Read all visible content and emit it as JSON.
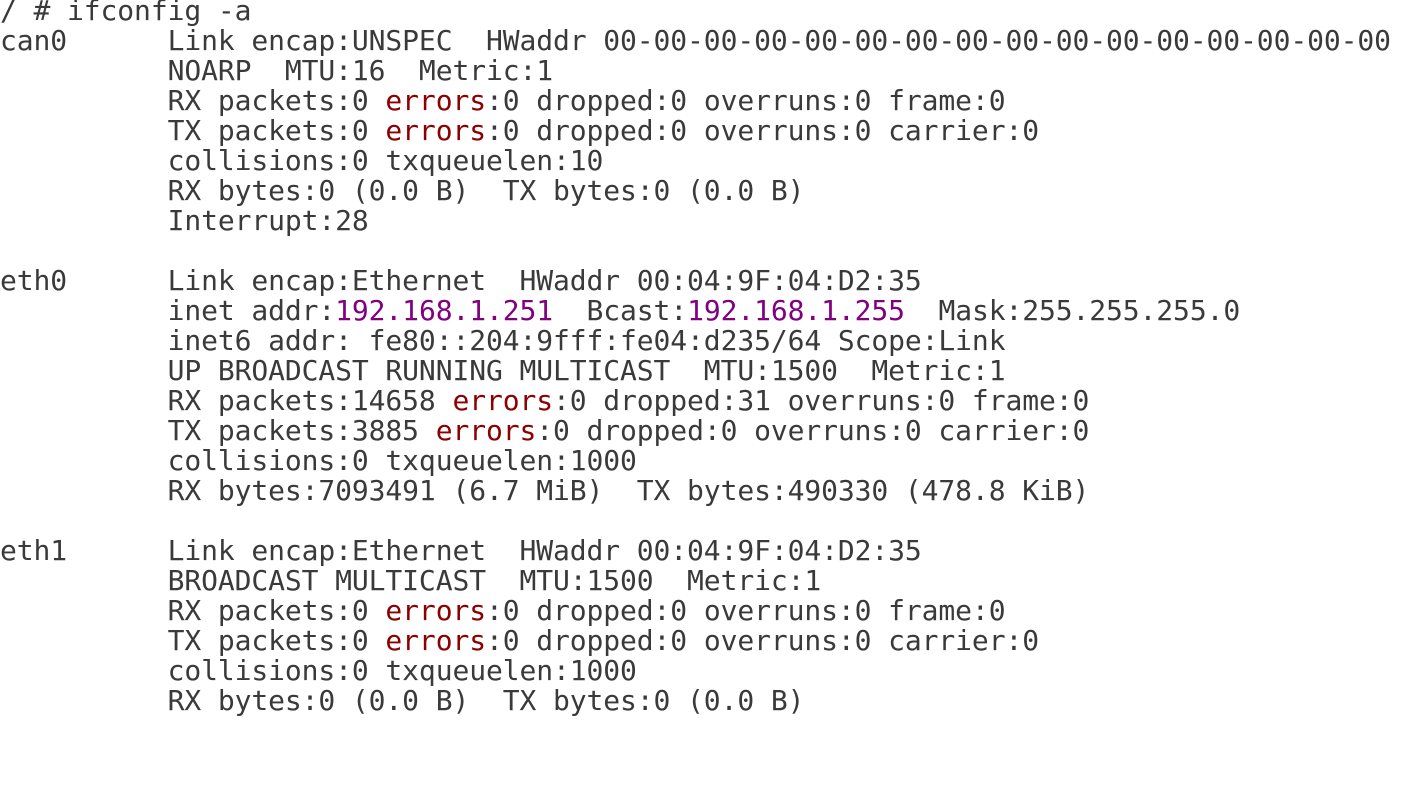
{
  "terminal": {
    "prompt_line": "/ # ifconfig -a",
    "lines": [
      [
        {
          "t": "/ # ifconfig -a"
        }
      ],
      [
        {
          "t": "can0      Link encap:UNSPEC  HWaddr 00-00-00-00-00-00-00-00-00-00-00-00-00-00-00-00"
        }
      ],
      [
        {
          "t": "          NOARP  MTU:16  Metric:1"
        }
      ],
      [
        {
          "t": "          RX packets:0 "
        },
        {
          "t": "errors",
          "c": "red"
        },
        {
          "t": ":0 dropped:0 overruns:0 frame:0"
        }
      ],
      [
        {
          "t": "          TX packets:0 "
        },
        {
          "t": "errors",
          "c": "red"
        },
        {
          "t": ":0 dropped:0 overruns:0 carrier:0"
        }
      ],
      [
        {
          "t": "          collisions:0 txqueuelen:10"
        }
      ],
      [
        {
          "t": "          RX bytes:0 (0.0 B)  TX bytes:0 (0.0 B)"
        }
      ],
      [
        {
          "t": "          Interrupt:28"
        }
      ],
      [
        {
          "t": ""
        }
      ],
      [
        {
          "t": "eth0      Link encap:Ethernet  HWaddr 00:04:9F:04:D2:35"
        }
      ],
      [
        {
          "t": "          inet addr:"
        },
        {
          "t": "192.168.1.251",
          "c": "purple"
        },
        {
          "t": "  Bcast:"
        },
        {
          "t": "192.168.1.255",
          "c": "purple"
        },
        {
          "t": "  Mask:255.255.255.0"
        }
      ],
      [
        {
          "t": "          inet6 addr: fe80::204:9fff:fe04:d235/64 Scope:Link"
        }
      ],
      [
        {
          "t": "          UP BROADCAST RUNNING MULTICAST  MTU:1500  Metric:1"
        }
      ],
      [
        {
          "t": "          RX packets:14658 "
        },
        {
          "t": "errors",
          "c": "red"
        },
        {
          "t": ":0 dropped:31 overruns:0 frame:0"
        }
      ],
      [
        {
          "t": "          TX packets:3885 "
        },
        {
          "t": "errors",
          "c": "red"
        },
        {
          "t": ":0 dropped:0 overruns:0 carrier:0"
        }
      ],
      [
        {
          "t": "          collisions:0 txqueuelen:1000"
        }
      ],
      [
        {
          "t": "          RX bytes:7093491 (6.7 MiB)  TX bytes:490330 (478.8 KiB)"
        }
      ],
      [
        {
          "t": ""
        }
      ],
      [
        {
          "t": "eth1      Link encap:Ethernet  HWaddr 00:04:9F:04:D2:35"
        }
      ],
      [
        {
          "t": "          BROADCAST MULTICAST  MTU:1500  Metric:1"
        }
      ],
      [
        {
          "t": "          RX packets:0 "
        },
        {
          "t": "errors",
          "c": "red"
        },
        {
          "t": ":0 dropped:0 overruns:0 frame:0"
        }
      ],
      [
        {
          "t": "          TX packets:0 "
        },
        {
          "t": "errors",
          "c": "red"
        },
        {
          "t": ":0 dropped:0 overruns:0 carrier:0"
        }
      ],
      [
        {
          "t": "          collisions:0 txqueuelen:1000"
        }
      ],
      [
        {
          "t": "          RX bytes:0 (0.0 B)  TX bytes:0 (0.0 B)"
        }
      ]
    ]
  },
  "colors": {
    "background": "#ffffff",
    "foreground": "#3a3a3a",
    "errors_keyword": "#8b0000",
    "ip_address": "#800080"
  }
}
